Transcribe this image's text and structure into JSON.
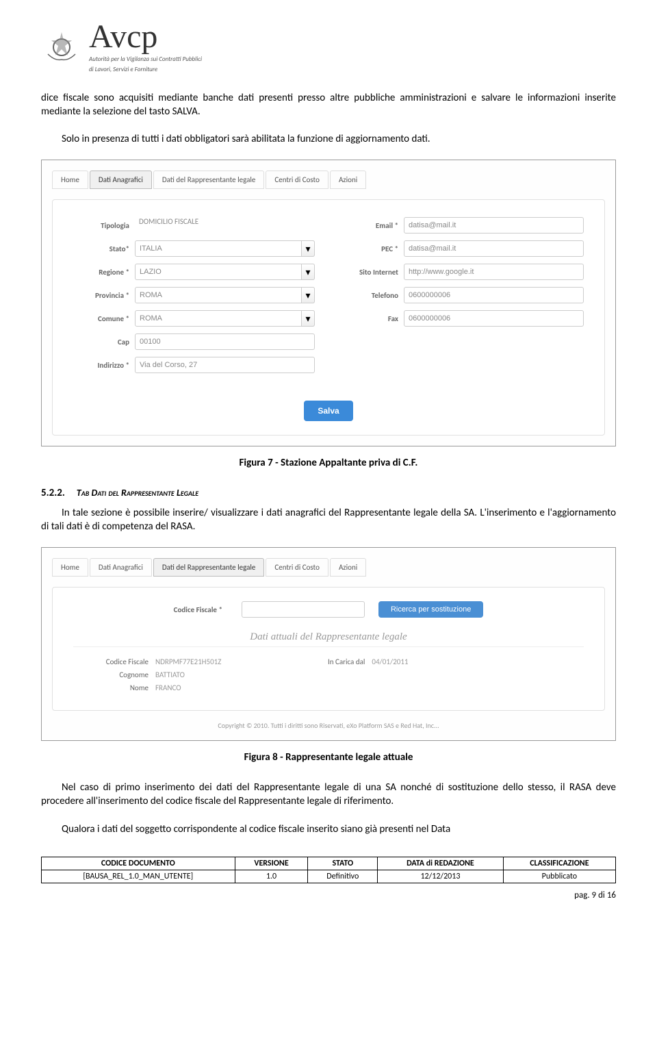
{
  "header": {
    "logo_text": "Avcp",
    "sub_line1": "Autorità per la Vigilanza sui Contratti Pubblici",
    "sub_line2": "di Lavori, Servizi e Forniture"
  },
  "para1": "dice fiscale sono acquisiti mediante banche dati presenti presso altre pubbliche amministrazioni e salvare le informazioni inserite mediante la selezione del tasto SALVA.",
  "para2": "Solo in presenza di tutti i dati obbligatori sarà abilitata la funzione di aggiornamento dati.",
  "screenshot1": {
    "tabs": [
      "Home",
      "Dati Anagrafici",
      "Dati del Rappresentante legale",
      "Centri di Costo",
      "Azioni"
    ],
    "active_tab": 1,
    "left_fields": {
      "tipologia_label": "Tipologia",
      "tipologia_value": "DOMICILIO FISCALE",
      "stato_label": "Stato*",
      "stato_value": "ITALIA",
      "regione_label": "Regione *",
      "regione_value": "LAZIO",
      "provincia_label": "Provincia *",
      "provincia_value": "ROMA",
      "comune_label": "Comune *",
      "comune_value": "ROMA",
      "cap_label": "Cap",
      "cap_value": "00100",
      "indirizzo_label": "Indirizzo *",
      "indirizzo_value": "Via del Corso, 27"
    },
    "right_fields": {
      "email_label": "Email *",
      "email_value": "datisa@mail.it",
      "pec_label": "PEC *",
      "pec_value": "datisa@mail.it",
      "sito_label": "Sito Internet",
      "sito_value": "http://www.google.it",
      "telefono_label": "Telefono",
      "telefono_value": "0600000006",
      "fax_label": "Fax",
      "fax_value": "0600000006"
    },
    "salva_label": "Salva"
  },
  "figure7_caption": "Figura 7 - Stazione Appaltante priva di C.F.",
  "section": {
    "num": "5.2.2.",
    "title": "Tab Dati del Rappresentante Legale"
  },
  "para3": "In tale sezione è possibile inserire/ visualizzare i dati anagrafici del Rappresentante legale della SA. L'inserimento e l'aggiornamento di tali dati è di competenza del RASA.",
  "screenshot2": {
    "tabs": [
      "Home",
      "Dati Anagrafici",
      "Dati del Rappresentante legale",
      "Centri di Costo",
      "Azioni"
    ],
    "active_tab": 2,
    "cf_label": "Codice Fiscale *",
    "ricerca_label": "Ricerca per sostituzione",
    "subtitle": "Dati attuali del Rappresentante legale",
    "details": {
      "cf_label": "Codice Fiscale",
      "cf_value": "NDRPMF77E21H501Z",
      "cognome_label": "Cognome",
      "cognome_value": "BATTIATO",
      "nome_label": "Nome",
      "nome_value": "FRANCO",
      "incarica_label": "In Carica dal",
      "incarica_value": "04/01/2011"
    },
    "copyright": "Copyright © 2010. Tutti i diritti sono Riservati, eXo Platform SAS e Red Hat, Inc..."
  },
  "figure8_caption": "Figura 8 - Rappresentante legale attuale",
  "para4": "Nel caso di primo inserimento dei dati del Rappresentante legale di una SA nonché di sostituzione dello stesso, il RASA deve procedere all'inserimento del codice fiscale del Rappresentante legale di riferimento.",
  "para5": "Qualora i dati del soggetto corrispondente al codice fiscale inserito siano già presenti nel Data",
  "footer": {
    "codice_hdr": "CODICE DOCUMENTO",
    "codice_val": "[BAUSA_REL_1.0_MAN_UTENTE]",
    "versione_hdr": "VERSIONE",
    "versione_val": "1.0",
    "stato_hdr": "STATO",
    "stato_val": "Definitivo",
    "data_hdr": "DATA di REDAZIONE",
    "data_val": "12/12/2013",
    "class_hdr": "CLASSIFICAZIONE",
    "class_val": "Pubblicato"
  },
  "page_num": "pag. 9 di 16"
}
